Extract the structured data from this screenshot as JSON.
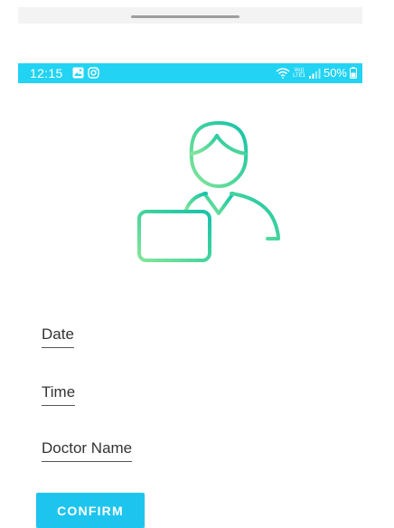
{
  "status_bar": {
    "time": "12:15",
    "battery": "50%",
    "network_label": "LTE1",
    "volte_label": "Vo))",
    "background_color": "#22d3f3"
  },
  "icons": {
    "gallery": "gallery-icon",
    "instagram": "instagram-icon",
    "wifi": "wifi-icon",
    "signal": "signal-icon",
    "battery": "battery-icon",
    "hero": "doctor-calendar-icon"
  },
  "form": {
    "date_label": "Date",
    "time_label": "Time",
    "doctor_label": "Doctor Name"
  },
  "actions": {
    "confirm_label": "CONFIRM"
  },
  "colors": {
    "accent": "#1dc5ee",
    "illustration_gradient_start": "#7ee08a",
    "illustration_gradient_end": "#1fc7a6"
  }
}
